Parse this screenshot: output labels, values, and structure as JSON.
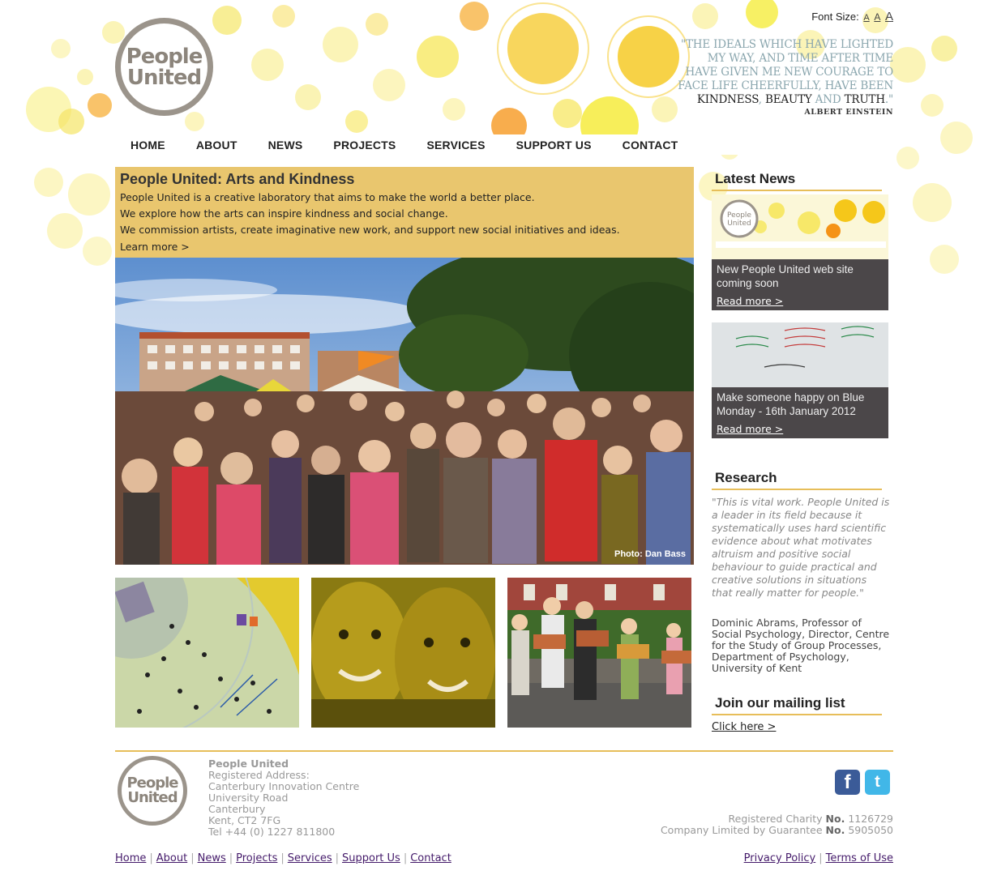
{
  "header": {
    "logo_text_1": "People",
    "logo_text_2": "United",
    "font_size_label": "Font Size:",
    "font_size_small": "A",
    "font_size_medium": "A",
    "font_size_large": "A",
    "quote_light_1": "\"THE IDEALS WHICH HAVE LIGHTED MY WAY, AND TIME AFTER TIME HAVE GIVEN ME NEW COURAGE TO FACE LIFE CHEERFULLY, HAVE BEEN",
    "quote_word_kindness": "KINDNESS",
    "quote_sep_1": ", ",
    "quote_word_beauty": "BEAUTY",
    "quote_and": " AND ",
    "quote_word_truth": "TRUTH",
    "quote_end": ".\"",
    "quote_author": "ALBERT EINSTEIN"
  },
  "nav": [
    "HOME",
    "ABOUT",
    "NEWS",
    "PROJECTS",
    "SERVICES",
    "SUPPORT US",
    "CONTACT"
  ],
  "intro": {
    "title": "People United: Arts and Kindness",
    "line_1": "People United is a creative laboratory that aims to make the world a better place.",
    "line_2": "We explore how the arts can inspire kindness and social change.",
    "line_3": "We commission artists, create imaginative new work, and support new social initiatives and ideas.",
    "learn_more": "Learn more >",
    "photo_credit": "Photo: Dan Bass"
  },
  "sidebar": {
    "latest_news_heading": "Latest News",
    "news": [
      {
        "title": "New People United web site coming soon",
        "more": "Read more >"
      },
      {
        "title": "Make someone happy on Blue Monday - 16th January 2012",
        "more": "Read more >"
      }
    ],
    "research_heading": "Research",
    "research_quote": "\"This is vital work. People United is a leader in its field because it systematically uses hard scientific evidence about what motivates altruism and positive social behaviour to guide practical and creative solutions in situations that really matter for people.\"",
    "research_credit": "Dominic Abrams, Professor of Social Psychology, Director, Centre for the Study of Group Processes, Department of Psychology, University of Kent",
    "mailing_heading": "Join our mailing list",
    "mailing_link": "Click here >"
  },
  "footer": {
    "org": "People United",
    "address": [
      "Registered Address:",
      "Canterbury Innovation Centre",
      "University Road",
      "Canterbury",
      "Kent, CT2 7FG",
      "Tel +44 (0) 1227 811800"
    ],
    "charity_label": "Registered Charity",
    "charity_no_label": "No.",
    "charity_no": "1126729",
    "company_label": "Company Limited by Guarantee",
    "company_no_label": "No.",
    "company_no": "5905050",
    "links": [
      "Home",
      "About",
      "News",
      "Projects",
      "Services",
      "Support Us",
      "Contact"
    ],
    "privacy": "Privacy Policy",
    "terms": "Terms of Use",
    "social": {
      "facebook": "f",
      "twitter": "t"
    }
  },
  "colors": {
    "accent": "#e7be5a",
    "bubble_yellow": "#f5e63a",
    "bubble_orange": "#f7a61b",
    "link": "#441a6a"
  }
}
